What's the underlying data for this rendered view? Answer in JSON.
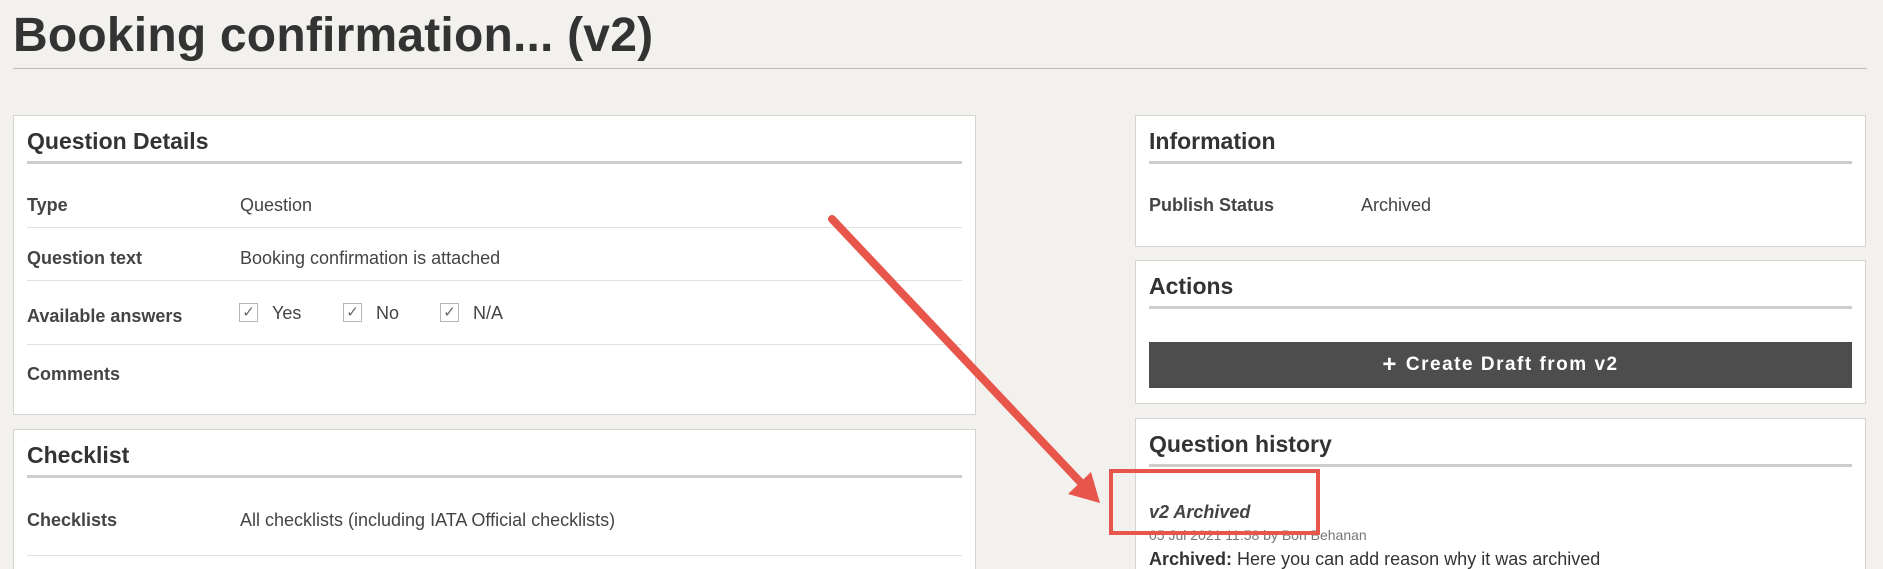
{
  "page": {
    "title": "Booking confirmation... (v2)"
  },
  "question_details": {
    "title": "Question Details",
    "rows": [
      {
        "label": "Type",
        "value": "Question"
      },
      {
        "label": "Question text",
        "value": "Booking confirmation is attached"
      },
      {
        "label": "Available answers",
        "answers": [
          "Yes",
          "No",
          "N/A"
        ]
      },
      {
        "label": "Comments",
        "value": ""
      }
    ],
    "check_glyph": "✓"
  },
  "checklist": {
    "title": "Checklist",
    "rows": [
      {
        "label": "Checklists",
        "value": "All checklists (including IATA Official checklists)"
      }
    ]
  },
  "information": {
    "title": "Information",
    "rows": [
      {
        "label": "Publish Status",
        "value": "Archived"
      }
    ]
  },
  "actions": {
    "title": "Actions",
    "create_draft_label": "Create Draft from v2",
    "create_draft_icon": "plus-icon",
    "plus_glyph": "+"
  },
  "history": {
    "title": "Question history",
    "entry": {
      "version": "v2 Archived",
      "meta": "05 Jul 2021 11:58 by Bon Behanan",
      "reason_label": "Archived:",
      "reason_text": "Here you can add reason why it was archived"
    }
  },
  "annotation_colors": {
    "arrow": "#e8554a",
    "highlight_box": "#e8554a"
  }
}
